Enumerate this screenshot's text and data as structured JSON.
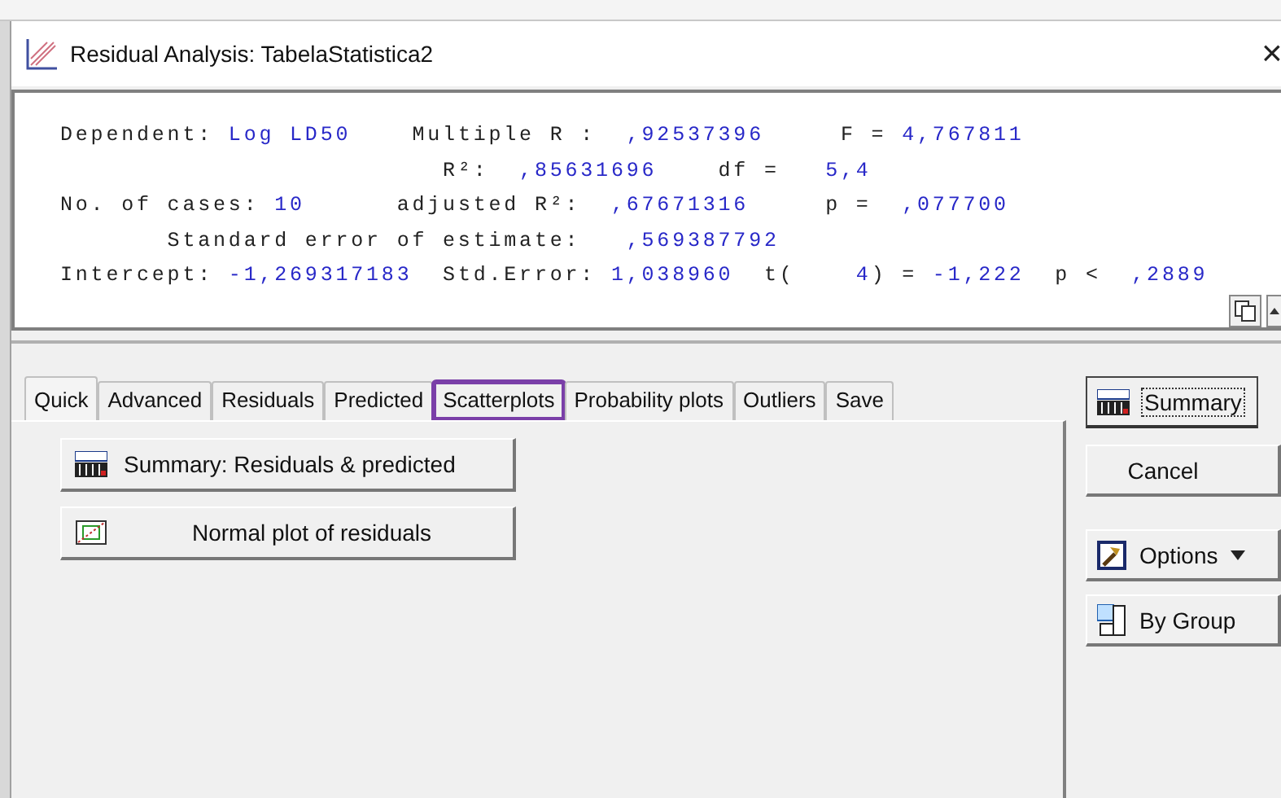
{
  "window": {
    "title": "Residual Analysis: TabelaStatistica2",
    "close": "×"
  },
  "results": {
    "lines": [
      [
        {
          "kind": "label",
          "text": "Dependent: "
        },
        {
          "kind": "value",
          "text": "Log LD50"
        },
        {
          "kind": "label",
          "text": "    Multiple R :  "
        },
        {
          "kind": "value",
          "text": ",92537396"
        },
        {
          "kind": "label",
          "text": "     F = "
        },
        {
          "kind": "value",
          "text": "4,767811"
        }
      ],
      [
        {
          "kind": "label",
          "text": "                         R²:  "
        },
        {
          "kind": "value",
          "text": ",85631696"
        },
        {
          "kind": "label",
          "text": "    df =   "
        },
        {
          "kind": "value",
          "text": "5,4"
        }
      ],
      [
        {
          "kind": "label",
          "text": "No. of cases: "
        },
        {
          "kind": "value",
          "text": "10"
        },
        {
          "kind": "label",
          "text": "      adjusted R²:  "
        },
        {
          "kind": "value",
          "text": ",67671316"
        },
        {
          "kind": "label",
          "text": "     p =  "
        },
        {
          "kind": "value",
          "text": ",077700"
        }
      ],
      [
        {
          "kind": "label",
          "text": "       Standard error of estimate:   "
        },
        {
          "kind": "value",
          "text": ",569387792"
        }
      ],
      [
        {
          "kind": "label",
          "text": "Intercept: "
        },
        {
          "kind": "value",
          "text": "-1,269317183"
        },
        {
          "kind": "label",
          "text": "  Std.Error: "
        },
        {
          "kind": "value",
          "text": "1,038960"
        },
        {
          "kind": "label",
          "text": "  t(    "
        },
        {
          "kind": "value",
          "text": "4"
        },
        {
          "kind": "label",
          "text": ") = "
        },
        {
          "kind": "value",
          "text": "-1,222"
        },
        {
          "kind": "label",
          "text": "  p <  "
        },
        {
          "kind": "value",
          "text": ",2889"
        }
      ]
    ]
  },
  "tabs": [
    {
      "label": "Quick",
      "selected": true,
      "highlighted": false
    },
    {
      "label": "Advanced",
      "selected": false,
      "highlighted": false
    },
    {
      "label": "Residuals",
      "selected": false,
      "highlighted": false
    },
    {
      "label": "Predicted",
      "selected": false,
      "highlighted": false
    },
    {
      "label": "Scatterplots",
      "selected": false,
      "highlighted": true
    },
    {
      "label": "Probability plots",
      "selected": false,
      "highlighted": false
    },
    {
      "label": "Outliers",
      "selected": false,
      "highlighted": false
    },
    {
      "label": "Save",
      "selected": false,
      "highlighted": false
    }
  ],
  "quick_buttons": [
    {
      "kind": "summary",
      "label": "Summary:  Residuals & predicted"
    },
    {
      "kind": "normal",
      "label": "Normal plot of residuals"
    }
  ],
  "side_buttons": [
    {
      "kind": "summary",
      "label": "Summary",
      "focused": true
    },
    {
      "kind": "cancel",
      "label": "Cancel",
      "focused": false
    },
    {
      "kind": "options",
      "label": "Options",
      "focused": false
    },
    {
      "kind": "bygroup",
      "label": "By Group",
      "focused": false
    }
  ]
}
